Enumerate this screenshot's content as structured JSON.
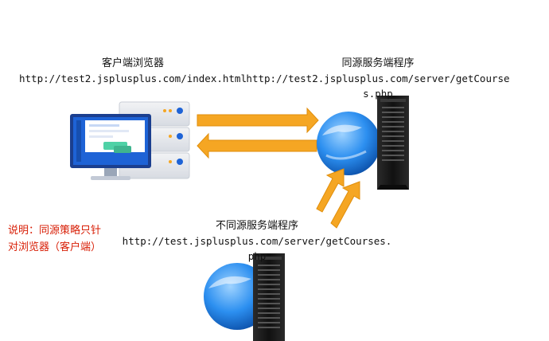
{
  "client": {
    "title": "客户端浏览器",
    "url": "http://test2.jsplusplus.com/index.html"
  },
  "same_origin_server": {
    "title": "同源服务端程序",
    "url": "http://test2.jsplusplus.com/server/getCourses.php"
  },
  "other_origin_server": {
    "title": "不同源服务端程序",
    "url": "http://test.jsplusplus.com/server/getCourses.php"
  },
  "note": {
    "line1": "说明：同源策略只针",
    "line2": "对浏览器（客户端）"
  },
  "colors": {
    "arrow": "#f5a623",
    "note": "#d81e06",
    "monitor_screen": "#1e63d6",
    "globe": "#2c8ff0",
    "server_body": "#1b1b1b"
  }
}
